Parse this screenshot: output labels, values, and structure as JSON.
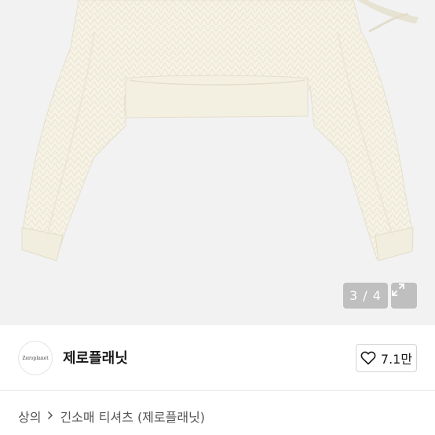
{
  "gallery": {
    "pager_text": "3 / 4",
    "expand_icon": "expand-arrows-icon"
  },
  "seller": {
    "avatar_text": "Zeroplanet",
    "name": "제로플래닛",
    "like_icon": "heart-outline-icon",
    "like_count": "7.1만"
  },
  "breadcrumb": {
    "category": "상의",
    "separator_icon": "chevron-right-icon",
    "item": "긴소매 티셔츠 (제로플래닛)"
  }
}
